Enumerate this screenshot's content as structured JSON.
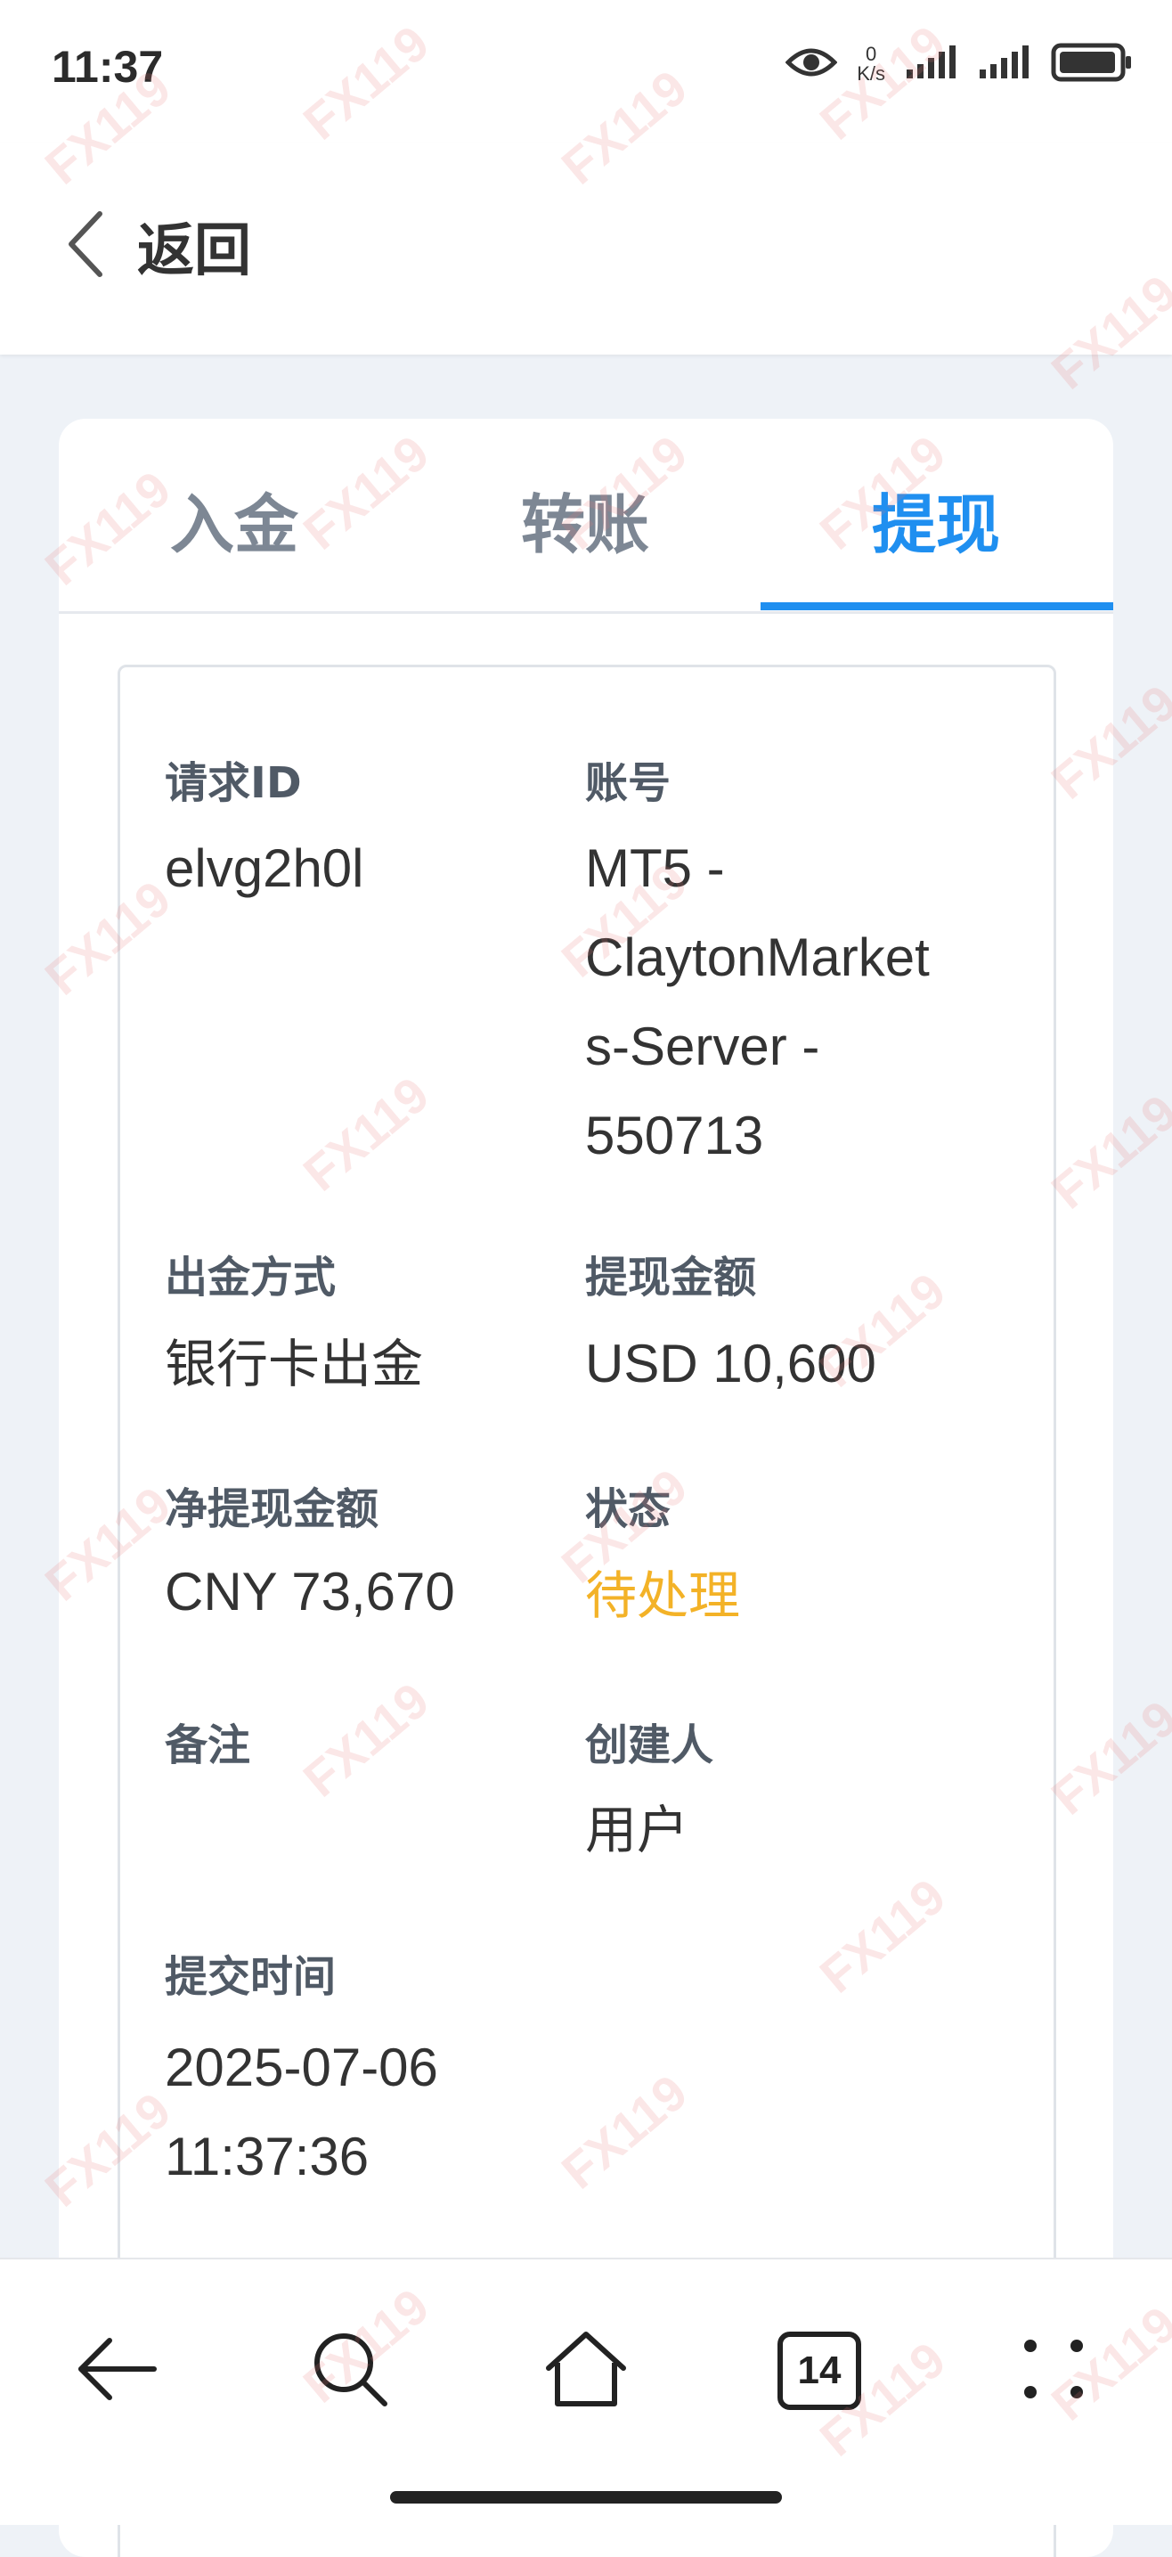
{
  "status_bar": {
    "time": "11:37",
    "net_speed_value": "0",
    "net_speed_unit": "K/s"
  },
  "header": {
    "back_label": "返回"
  },
  "tabs": [
    {
      "label": "入金",
      "active": false
    },
    {
      "label": "转账",
      "active": false
    },
    {
      "label": "提现",
      "active": true
    }
  ],
  "detail": {
    "request_id_label": "请求ID",
    "request_id_value": "elvg2h0l",
    "account_label": "账号",
    "account_value_lines": [
      "MT5 -",
      "ClaytonMarket",
      "s-Server -",
      "550713"
    ],
    "method_label": "出金方式",
    "method_value": "银行卡出金",
    "amount_label": "提现金额",
    "amount_value": "USD 10,600",
    "net_amount_label": "净提现金额",
    "net_amount_value": "CNY 73,670",
    "status_label": "状态",
    "status_value": "待处理",
    "remark_label": "备注",
    "remark_value": "",
    "creator_label": "创建人",
    "creator_value": "用户",
    "submit_time_label": "提交时间",
    "submit_time_lines": [
      "2025-07-06",
      "11:37:36"
    ]
  },
  "bottom_nav": {
    "tab_count": "14"
  },
  "watermark": "FX119",
  "colors": {
    "accent": "#1f8ff0",
    "pending": "#f3b227",
    "background": "#eef2f7"
  }
}
